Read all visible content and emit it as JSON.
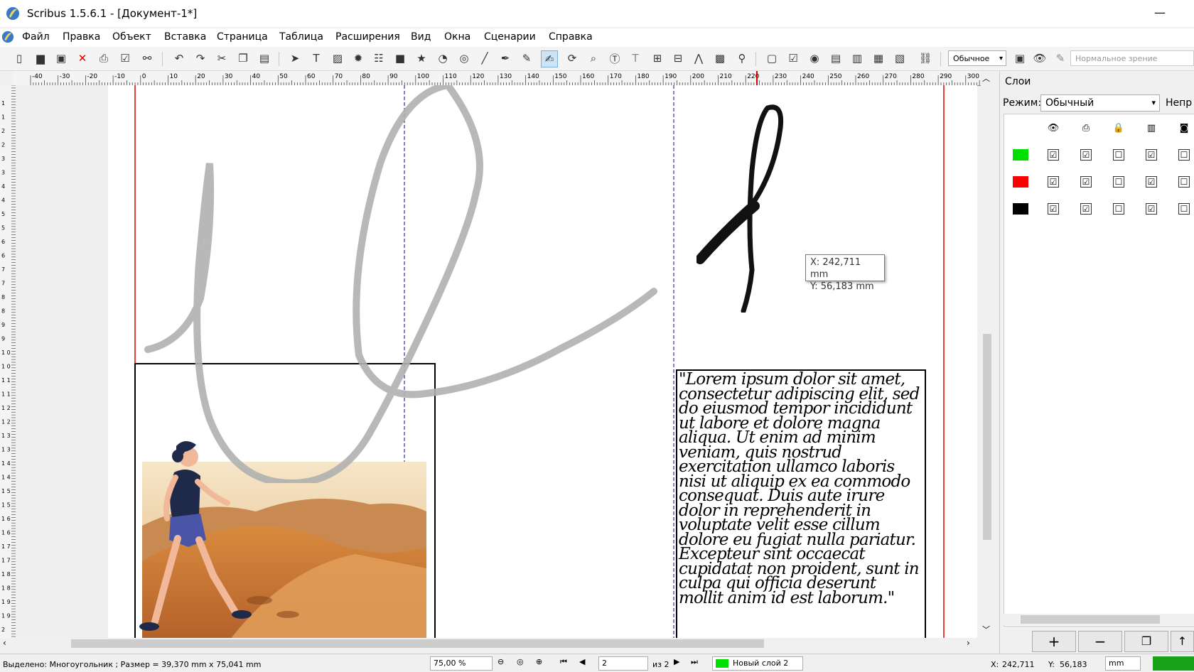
{
  "window": {
    "title": "Scribus 1.5.6.1 - [Документ-1*]",
    "minimize": "—"
  },
  "menu": [
    "Файл",
    "Правка",
    "Объект",
    "Вставка",
    "Страница",
    "Таблица",
    "Расширения",
    "Вид",
    "Окна",
    "Сценарии",
    "Справка"
  ],
  "toolbar": {
    "quality_combo": "Обычное",
    "vision_combo": "Нормальное зрение",
    "icons": [
      "new-document-icon",
      "open-icon",
      "save-icon",
      "close-icon",
      "print-icon",
      "preflight-check-icon",
      "export-pdf-icon",
      "undo-icon",
      "redo-icon",
      "cut-icon",
      "copy-icon",
      "paste-icon",
      "select-icon",
      "text-frame-icon",
      "image-frame-icon",
      "render-frame-icon",
      "table-icon",
      "shape-icon",
      "polygon-icon",
      "arc-icon",
      "spiral-icon",
      "line-icon",
      "bezier-icon",
      "freehand-icon",
      "calligraphic-line-icon",
      "rotate-icon",
      "zoom-icon",
      "edit-contents-icon",
      "edit-text-icon",
      "link-frames-icon",
      "unlink-frames-icon",
      "measure-icon",
      "copy-properties-icon",
      "eyedropper-icon",
      "pdf-push-button-icon",
      "pdf-checkbox-icon",
      "pdf-radio-icon",
      "pdf-text-field-icon",
      "pdf-combo-box-icon",
      "pdf-list-box-icon",
      "pdf-text-annotation-icon",
      "pdf-link-annotation-icon",
      "preview-mode-icon",
      "eye-icon",
      "edit-in-preview-icon"
    ]
  },
  "rulers": {
    "horizontal_labels": [
      "-40",
      "-30",
      "-20",
      "-10",
      "0",
      "10",
      "20",
      "30",
      "40",
      "50",
      "60",
      "70",
      "80",
      "90",
      "100",
      "110",
      "120",
      "130",
      "140",
      "150",
      "160",
      "170",
      "180",
      "190",
      "200",
      "210",
      "220",
      "230",
      "240",
      "250",
      "260",
      "270",
      "280",
      "290",
      "300"
    ],
    "vertical_labels": [
      "1",
      "1",
      "2",
      "2",
      "3",
      "3",
      "4",
      "4",
      "5",
      "5",
      "6",
      "6",
      "7",
      "7",
      "8",
      "8",
      "9",
      "9",
      "1 0",
      "1 0",
      "1 1",
      "1 1",
      "1 2",
      "1 2",
      "1 3",
      "1 3",
      "1 4",
      "1 4",
      "1 5",
      "1 5",
      "1 6",
      "1 6",
      "1 7",
      "1 7",
      "1 8",
      "1 8",
      "1 9",
      "1 9",
      "2"
    ]
  },
  "canvas": {
    "coord_tooltip": {
      "x": "X: 242,711  mm",
      "y": "Y: 56,183  mm"
    },
    "lorem_text": "\"Lorem ipsum dolor sit amet, consectetur adipiscing elit, sed do eiusmod tempor incididunt ut labore et dolore magna aliqua. Ut enim ad minim veniam, quis nostrud exercitation ullamco laboris nisi ut aliquip ex ea commodo consequat. Duis aute irure dolor in reprehenderit in voluptate velit esse cillum dolore eu fugiat nulla pariatur. Excepteur sint occaecat cupidatat non proident, sunt in culpa qui officia deserunt mollit anim id est laborum.\""
  },
  "layers_panel": {
    "title": "Слои",
    "mode_label": "Режим:",
    "mode_value": "Обычный",
    "opacity_label": "Непр",
    "header_icons": [
      "visible-eye-icon",
      "printable-icon",
      "lock-icon",
      "flow-icon",
      "outline-icon"
    ],
    "rows": [
      {
        "color": "#00e000",
        "checks": [
          "☑",
          "☑",
          "☐",
          "☑",
          "☐"
        ]
      },
      {
        "color": "#ff0000",
        "checks": [
          "☑",
          "☑",
          "☐",
          "☑",
          "☐"
        ]
      },
      {
        "color": "#000000",
        "checks": [
          "☑",
          "☑",
          "☐",
          "☑",
          "☐"
        ]
      }
    ],
    "buttons": [
      "+",
      "−"
    ]
  },
  "status": {
    "selection": "Выделено: Многоугольник ; Размер = 39,370  mm x 75,041  mm",
    "zoom": "75,00 %",
    "page": "2",
    "page_of": "из 2",
    "layer": "Новый слой 2",
    "x_label": "X:",
    "x_value": "242,711",
    "y_label": "Y:",
    "y_value": "56,183",
    "unit": "mm"
  }
}
